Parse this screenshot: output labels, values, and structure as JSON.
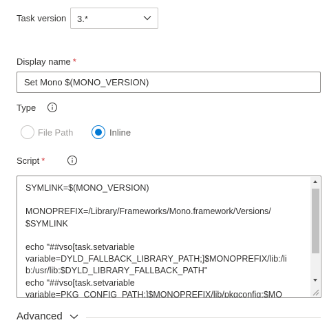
{
  "task_version": {
    "label": "Task version",
    "value": "3.*",
    "icon": "chevron-down-icon"
  },
  "display_name": {
    "label": "Display name",
    "required_mark": "*",
    "value": "Set Mono $(MONO_VERSION)"
  },
  "type": {
    "label": "Type",
    "info_icon": "info-icon",
    "options": [
      {
        "label": "File Path",
        "selected": false
      },
      {
        "label": "Inline",
        "selected": true
      }
    ]
  },
  "script": {
    "label": "Script",
    "required_mark": "*",
    "info_icon": "info-icon",
    "value": "SYMLINK=$(MONO_VERSION)\n\nMONOPREFIX=/Library/Frameworks/Mono.framework/Versions/\n$SYMLINK\n\necho \"##vso[task.setvariable\nvariable=DYLD_FALLBACK_LIBRARY_PATH;]$MONOPREFIX/lib:/li\nb:/usr/lib:$DYLD_LIBRARY_FALLBACK_PATH\"\necho \"##vso[task.setvariable\nvariable=PKG_CONFIG_PATH;]$MONOPREFIX/lib/pkgconfig:$MO"
  },
  "advanced": {
    "label": "Advanced",
    "icon": "chevron-down-icon"
  },
  "colors": {
    "accent": "#0078d4",
    "required": "#d13438",
    "text": "#323130",
    "border": "#8a8886"
  }
}
